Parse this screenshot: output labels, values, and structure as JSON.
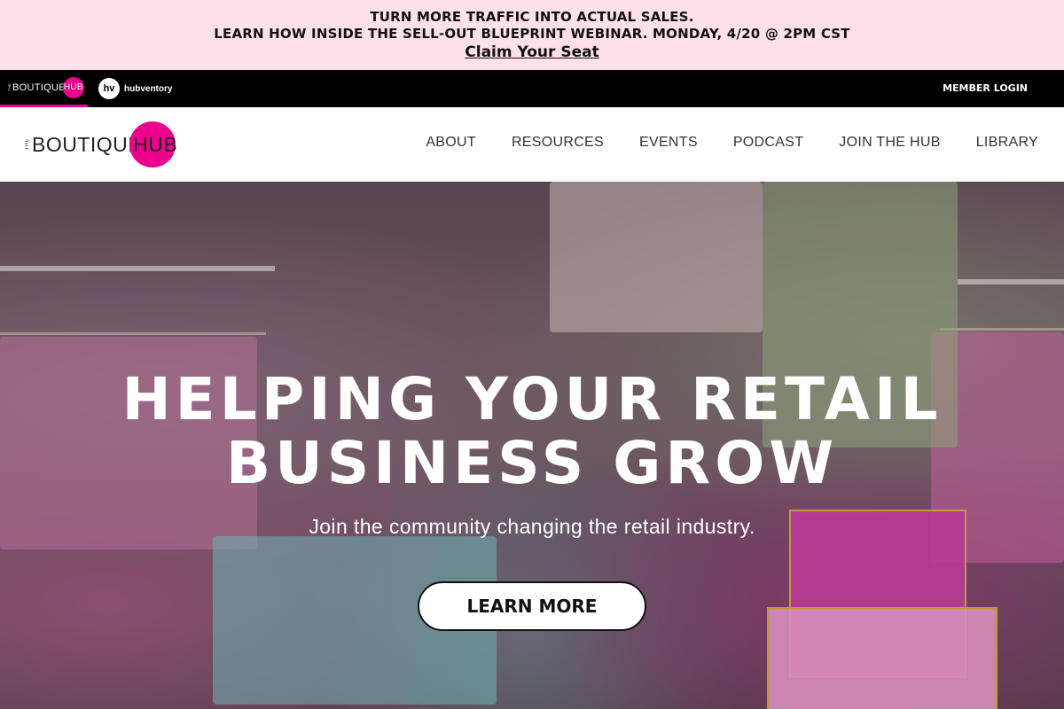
{
  "promo": {
    "line1": "TURN MORE TRAFFIC INTO ACTUAL SALES.",
    "line2": "LEARN HOW INSIDE THE SELL-OUT BLUEPRINT WEBINAR. MONDAY, 4/20 @ 2PM CST",
    "cta": "Claim Your Seat"
  },
  "brandbar": {
    "boutique_logo": {
      "the": "THE",
      "name": "BOUTIQUE",
      "hub": "HUB"
    },
    "hubventory_logo": {
      "mark": "hv",
      "name": "hubventory"
    },
    "member_login": "MEMBER LOGIN"
  },
  "header": {
    "logo": {
      "the": "THE",
      "boutique": "BOUTIQUE",
      "hub": "HUB"
    },
    "nav": [
      "ABOUT",
      "RESOURCES",
      "EVENTS",
      "PODCAST",
      "JOIN THE HUB",
      "LIBRARY"
    ]
  },
  "hero": {
    "title_line1": "HELPING YOUR RETAIL",
    "title_line2": "BUSINESS GROW",
    "subtitle": "Join the community changing the retail industry.",
    "button": "LEARN MORE"
  },
  "colors": {
    "promo_bg": "#fde0ea",
    "brand_pink": "#ec008c",
    "brand_bar": "#000000"
  }
}
